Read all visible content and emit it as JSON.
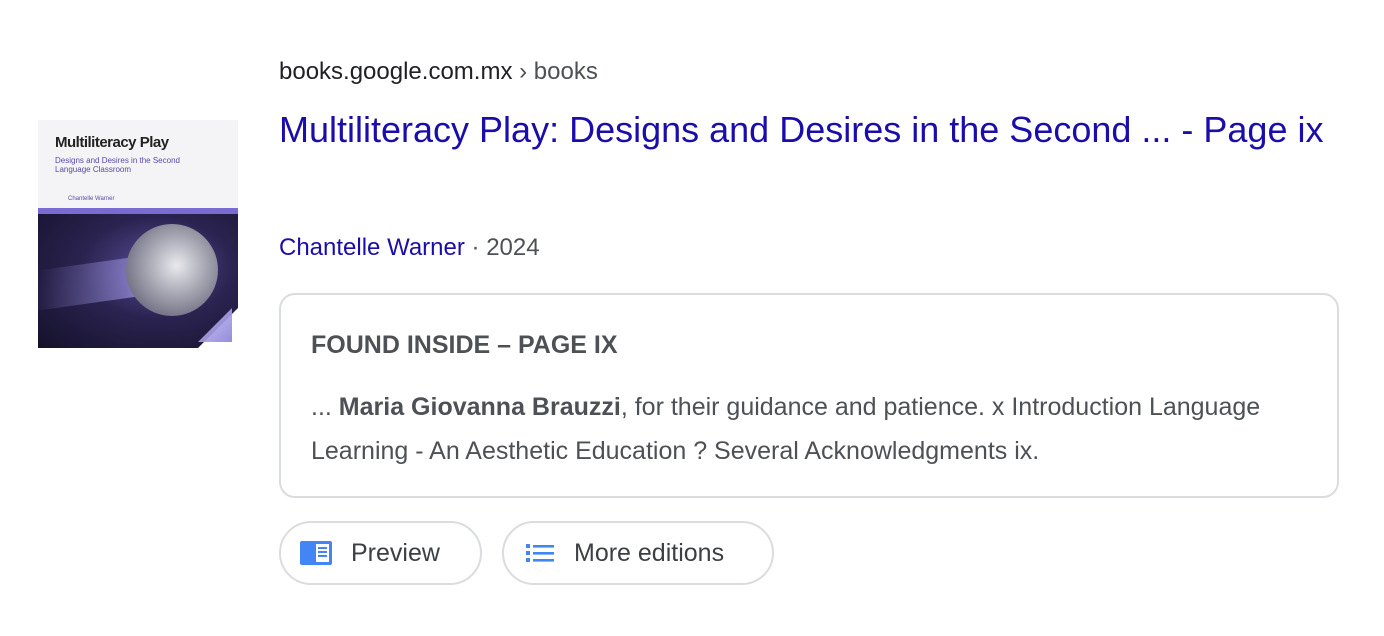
{
  "result": {
    "breadcrumb": {
      "domain": "books.google.com.mx",
      "separator": "›",
      "path": "books"
    },
    "title": "Multiliteracy Play: Designs and Desires in the Second ... - Page ix",
    "author": "Chantelle Warner",
    "dot": "·",
    "year": "2024",
    "snippet": {
      "heading": "FOUND INSIDE – PAGE IX",
      "prefix": "... ",
      "bold": "Maria Giovanna Brauzzi",
      "rest": ", for their guidance and patience. x Introduction Language Learning - An Aesthetic Education ? Several Acknowledgments ix."
    },
    "cover": {
      "title": "Multiliteracy Play",
      "subtitle": "Designs and Desires in the Second Language Classroom",
      "author": "Chantelle Warner",
      "icon": "book-cover-image"
    },
    "actions": [
      {
        "label": "Preview",
        "icon": "book-preview-icon"
      },
      {
        "label": "More editions",
        "icon": "list-icon"
      }
    ]
  },
  "colors": {
    "link": "#1a0dab",
    "text": "#4d5156",
    "border": "#dadce0",
    "icon_blue": "#4285f4"
  }
}
